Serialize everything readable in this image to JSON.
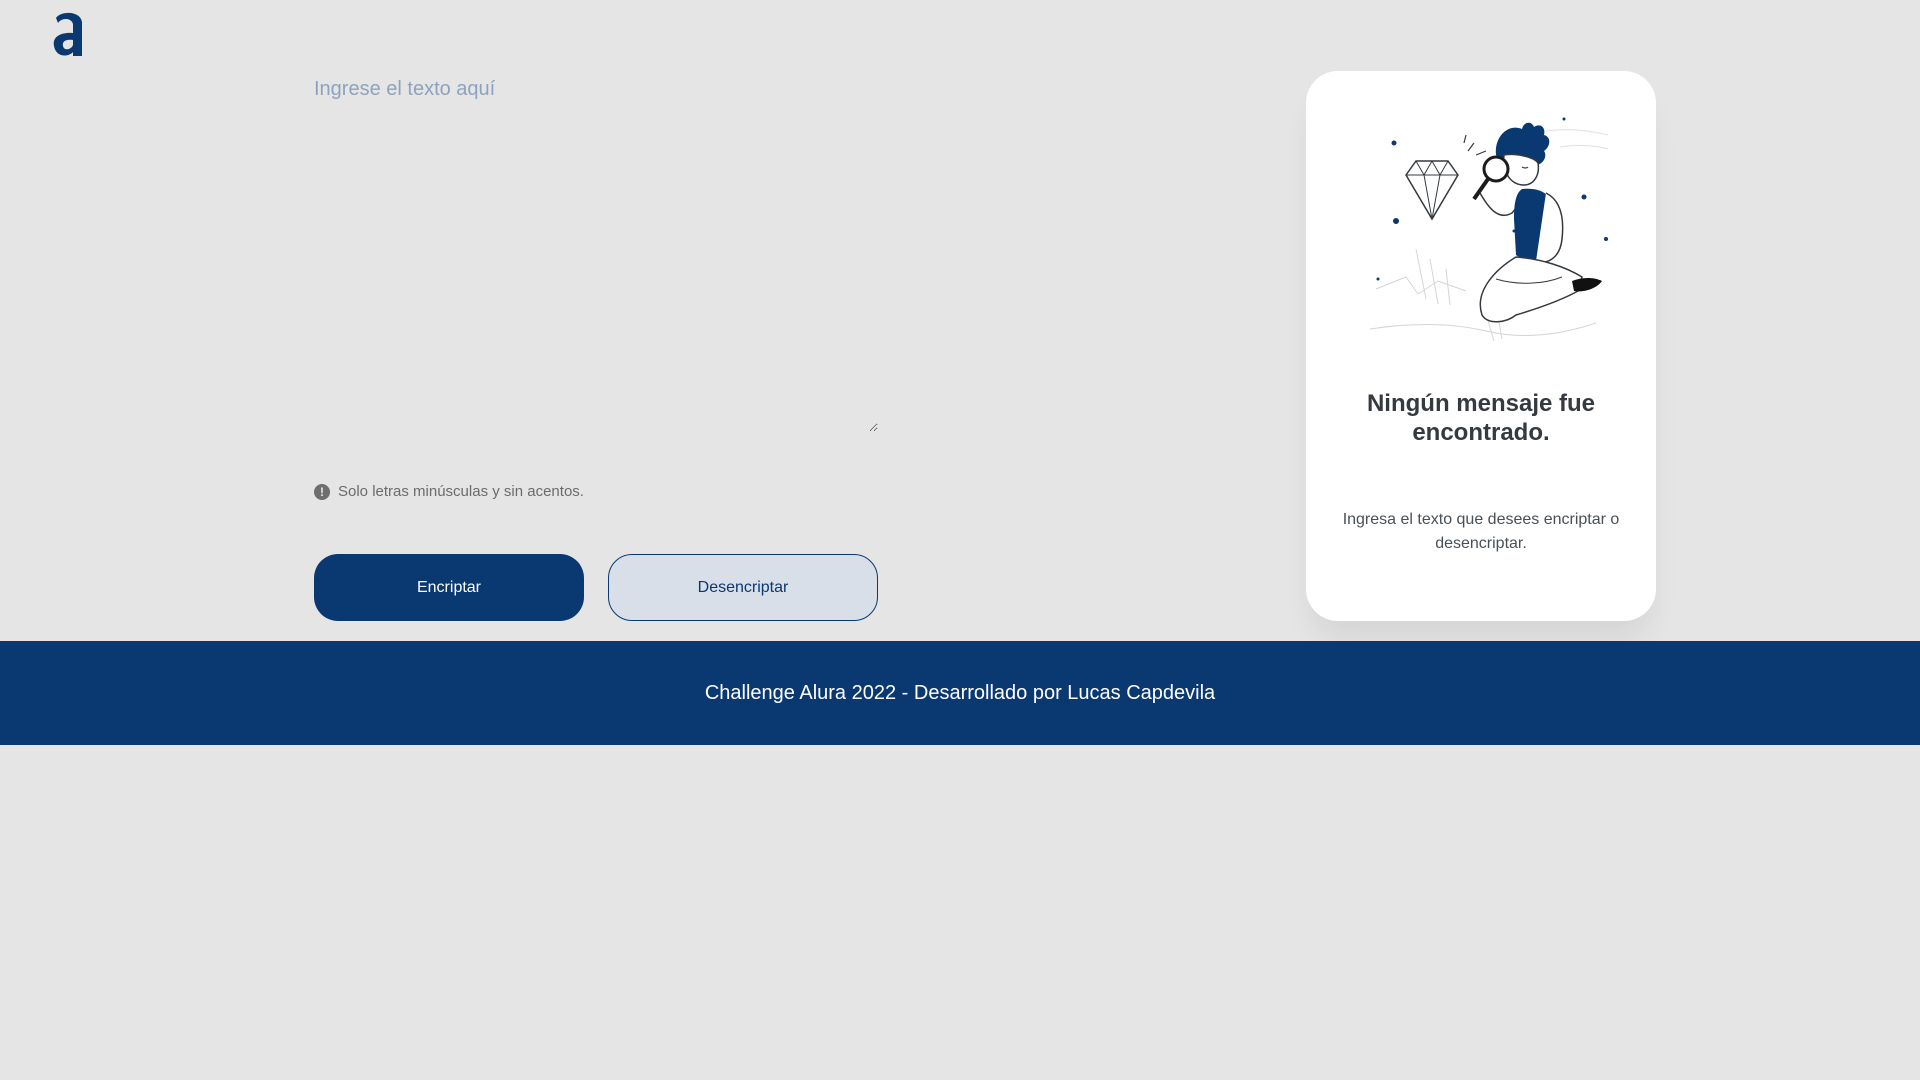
{
  "header": {
    "logo_icon": "alura-logo-icon"
  },
  "input": {
    "placeholder": "Ingrese el texto aquí",
    "value": ""
  },
  "hint": {
    "icon": "info-icon",
    "text": "Solo letras minúsculas y sin acentos."
  },
  "buttons": {
    "encrypt_label": "Encriptar",
    "decrypt_label": "Desencriptar"
  },
  "result_card": {
    "illustration": "person-with-magnifier-and-diamond-illustration",
    "title": "Ningún mensaje fue encontrado.",
    "text": "Ingresa el texto que desees encriptar o desencriptar."
  },
  "footer": {
    "text": "Challenge Alura 2022 - Desarrollado por Lucas Capdevila"
  },
  "colors": {
    "background": "#e5e5e5",
    "primary": "#0a3871",
    "secondary_button_bg": "#d8dfe8",
    "card_bg": "#ffffff",
    "placeholder": "#8fa2bd"
  }
}
